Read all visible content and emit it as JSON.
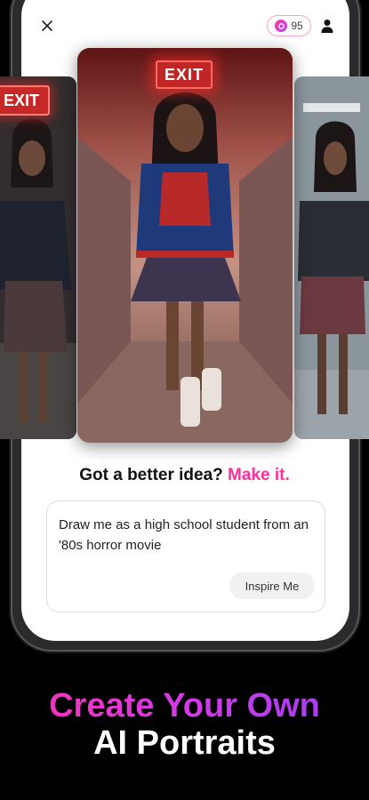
{
  "topbar": {
    "close_icon": "close-icon",
    "credits": "95",
    "credit_icon": "credit-coin-icon",
    "profile_icon": "person-icon"
  },
  "cards": {
    "center_sign": "EXIT",
    "left_sign": "EXIT"
  },
  "prompt": {
    "heading_prefix": "Got a better idea?",
    "heading_accent": "Make it.",
    "text": "Draw me as a high school student from an '80s horror movie",
    "inspire_label": "Inspire Me"
  },
  "headline": {
    "line1": "Create Your Own",
    "line2": "AI Portraits"
  },
  "colors": {
    "accent_pink": "#ff2f9c",
    "gradient_start": "#ff2fb0",
    "gradient_end": "#9a3df5"
  }
}
